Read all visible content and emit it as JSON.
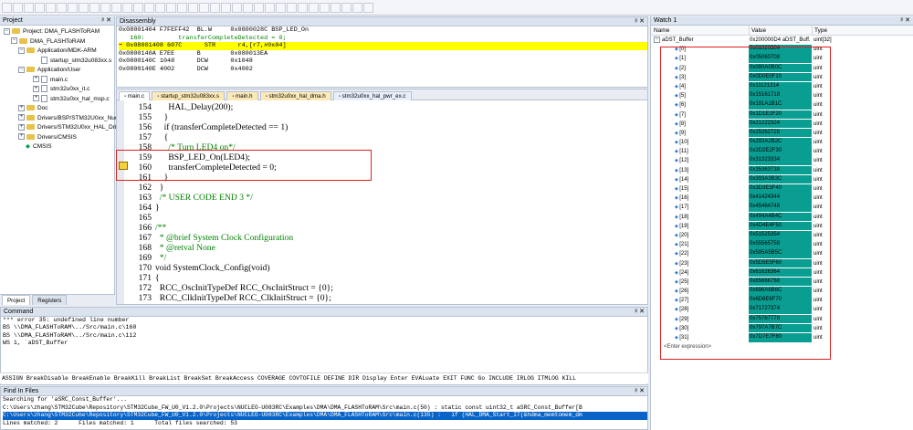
{
  "toolbar": {
    "icon_count": 34
  },
  "project": {
    "title": "Project",
    "items": [
      {
        "label": "Project: DMA_FLASHToRAM",
        "kind": "root"
      },
      {
        "label": "DMA_FLASHToRAM",
        "kind": "target"
      },
      {
        "label": "Application/MDK-ARM",
        "kind": "folder"
      },
      {
        "label": "startup_stm32u083xx.s",
        "kind": "file"
      },
      {
        "label": "Application/User",
        "kind": "folder"
      },
      {
        "label": "main.c",
        "kind": "file"
      },
      {
        "label": "stm32u0xx_it.c",
        "kind": "file"
      },
      {
        "label": "stm32u0xx_hal_msp.c",
        "kind": "file"
      },
      {
        "label": "Doc",
        "kind": "folder"
      },
      {
        "label": "Drivers/BSP/STM32U0xx_Nuc",
        "kind": "folder"
      },
      {
        "label": "Drivers/STM32U0xx_HAL_Dri",
        "kind": "folder"
      },
      {
        "label": "Drivers/CMSIS",
        "kind": "folder"
      },
      {
        "label": "CMSIS",
        "kind": "gem"
      }
    ],
    "tabs": [
      "Project",
      "Registers"
    ]
  },
  "disassembly": {
    "title": "Disassembly",
    "rows": [
      {
        "text": "0x08001404 F7FEFF42  BL.W     0x0800028C BSP_LED_On",
        "hl": false,
        "cm": false
      },
      {
        "text": "   160:         transferCompleteDetected = 0;",
        "hl": false,
        "cm": true
      },
      {
        "text": "0x08001408 607C      STR      r4,[r7,#0x04]",
        "hl": true,
        "cm": false
      },
      {
        "text": "0x0800140A E7EE      B        0x080013EA",
        "hl": false,
        "cm": false
      },
      {
        "text": "0x0800140C 1048      DCW      0x1048",
        "hl": false,
        "cm": false
      },
      {
        "text": "0x0800140E 4002      DCW      0x4002",
        "hl": false,
        "cm": false
      }
    ]
  },
  "editor": {
    "tabs": [
      {
        "label": "main.c",
        "style": "active"
      },
      {
        "label": "startup_stm32u083xx.s",
        "style": "normal"
      },
      {
        "label": "main.h",
        "style": "normal"
      },
      {
        "label": "stm32u0xx_hal_dma.h",
        "style": "normal"
      },
      {
        "label": "stm32u0xx_hal_pwr_ex.c",
        "style": "alt"
      }
    ],
    "lines": [
      {
        "n": "154",
        "t": "      HAL_Delay(200);",
        "cls": ""
      },
      {
        "n": "155",
        "t": "    }",
        "cls": ""
      },
      {
        "n": "156",
        "t": "    if (transferCompleteDetected == 1)",
        "cls": "if"
      },
      {
        "n": "157",
        "t": "    {",
        "cls": ""
      },
      {
        "n": "158",
        "t": "      /* Turn LED4 on*/",
        "cls": "cm"
      },
      {
        "n": "159",
        "t": "      BSP_LED_On(LED4);",
        "cls": ""
      },
      {
        "n": "160",
        "t": "      transferCompleteDetected = 0;",
        "cls": ""
      },
      {
        "n": "161",
        "t": "    }",
        "cls": ""
      },
      {
        "n": "162",
        "t": "  }",
        "cls": ""
      },
      {
        "n": "163",
        "t": "  /* USER CODE END 3 */",
        "cls": "cm"
      },
      {
        "n": "164",
        "t": "}",
        "cls": ""
      },
      {
        "n": "165",
        "t": "",
        "cls": ""
      },
      {
        "n": "166",
        "t": "/**",
        "cls": "cm"
      },
      {
        "n": "167",
        "t": "  * @brief System Clock Configuration",
        "cls": "cm"
      },
      {
        "n": "168",
        "t": "  * @retval None",
        "cls": "cm"
      },
      {
        "n": "169",
        "t": "  */",
        "cls": "cm"
      },
      {
        "n": "170",
        "t": "void SystemClock_Config(void)",
        "cls": "void"
      },
      {
        "n": "171",
        "t": "{",
        "cls": ""
      },
      {
        "n": "172",
        "t": "  RCC_OscInitTypeDef RCC_OscInitStruct = {0};",
        "cls": ""
      },
      {
        "n": "173",
        "t": "  RCC_ClkInitTypeDef RCC_ClkInitStruct = {0};",
        "cls": ""
      }
    ]
  },
  "command": {
    "title": "Command",
    "lines": [
      "*** error 35: undefined line number",
      "BS \\\\DMA_FLASHToRAM\\../Src/main.c\\160",
      "BS \\\\DMA_FLASHToRAM\\../Src/main.c\\112",
      "WS 1, `aDST_Buffer"
    ],
    "hints": "ASSIGN BreakDisable BreakEnable BreakKill BreakList BreakSet BreakAccess COVERAGE COVTOFILE DEFINE DIR Display Enter EVALuate EXIT FUNC Go INCLUDE IRLOG ITMLOG KILL"
  },
  "find": {
    "title": "Find In Files",
    "lines": [
      "Searching for 'aSRC_Const_Buffer'...",
      "C:\\Users\\zhang\\STM32Cube\\Repository\\STM32Cube_FW_U0_V1.2.0\\Projects\\NUCLEO-U083RC\\Examples\\DMA\\DMA_FLASHToRAM\\Src\\main.c(50) : static const uint32_t aSRC_Const_Buffer[B",
      "C:\\Users\\zhang\\STM32Cube\\Repository\\STM32Cube_FW_U0_V1.2.0\\Projects\\NUCLEO-U083RC\\Examples\\DMA\\DMA_FLASHToRAM\\Src\\main.c(135) :   if (HAL_DMA_Start_IT(&hdma_memtomem_dm",
      "Lines matched: 2      Files matched: 1      Total files searched: 53"
    ]
  },
  "watch": {
    "title": "Watch 1",
    "col_name": "Name",
    "col_value": "Value",
    "col_type": "Type",
    "root": {
      "name": "aDST_Buffer",
      "value": "0x200000D4 aDST_Buff...",
      "type": "uint[32]"
    },
    "items": [
      {
        "name": "[0]",
        "value": "0x01020304"
      },
      {
        "name": "[1]",
        "value": "0x05060708"
      },
      {
        "name": "[2]",
        "value": "0x090A0B0C"
      },
      {
        "name": "[3]",
        "value": "0x0D0E0F10"
      },
      {
        "name": "[4]",
        "value": "0x11121314"
      },
      {
        "name": "[5]",
        "value": "0x15161718"
      },
      {
        "name": "[6]",
        "value": "0x191A1B1C"
      },
      {
        "name": "[7]",
        "value": "0x1D1E1F20"
      },
      {
        "name": "[8]",
        "value": "0x21222324"
      },
      {
        "name": "[9]",
        "value": "0x25262728"
      },
      {
        "name": "[10]",
        "value": "0x292A2B2C"
      },
      {
        "name": "[11]",
        "value": "0x2D2E2F30"
      },
      {
        "name": "[12]",
        "value": "0x31323334"
      },
      {
        "name": "[13]",
        "value": "0x35363738"
      },
      {
        "name": "[14]",
        "value": "0x393A3B3C"
      },
      {
        "name": "[15]",
        "value": "0x3D3E3F40"
      },
      {
        "name": "[16]",
        "value": "0x41424344"
      },
      {
        "name": "[17]",
        "value": "0x45464748"
      },
      {
        "name": "[18]",
        "value": "0x494A4B4C"
      },
      {
        "name": "[19]",
        "value": "0x4D4E4F50"
      },
      {
        "name": "[20]",
        "value": "0x51525354"
      },
      {
        "name": "[21]",
        "value": "0x55565758"
      },
      {
        "name": "[22]",
        "value": "0x595A5B5C"
      },
      {
        "name": "[23]",
        "value": "0x5D5E5F60"
      },
      {
        "name": "[24]",
        "value": "0x61626364"
      },
      {
        "name": "[25]",
        "value": "0x65666768"
      },
      {
        "name": "[26]",
        "value": "0x696A6B6C"
      },
      {
        "name": "[27]",
        "value": "0x6D6E6F70"
      },
      {
        "name": "[28]",
        "value": "0x71727374"
      },
      {
        "name": "[29]",
        "value": "0x75767778"
      },
      {
        "name": "[30]",
        "value": "0x797A7B7C"
      },
      {
        "name": "[31]",
        "value": "0x7D7E7F80"
      }
    ],
    "item_type": "uint",
    "enter_expr": "<Enter expression>"
  },
  "colors": {
    "teal": "#0a9d92",
    "highlight": "#ffff00",
    "red": "#e02020",
    "blue_sel": "#0a64c8"
  }
}
